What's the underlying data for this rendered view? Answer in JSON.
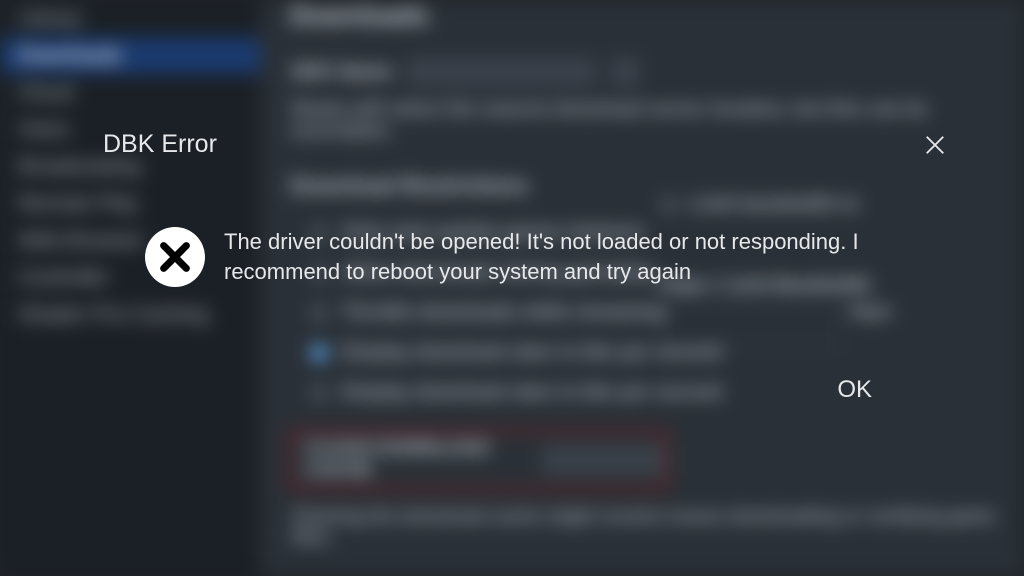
{
  "bg": {
    "sidebar": [
      "Library",
      "Downloads",
      "Cloud",
      "Voice",
      "Broadcasting",
      "Remote Play",
      "Web Browser",
      "Controller",
      "Shader Pre-Caching"
    ],
    "sidebar_selected_index": 1,
    "section_title": "Downloads",
    "region_label": "SDK Name",
    "region_desc": "Steam will select the nearest download server location, but this can be overridden.",
    "sub_header": "Download Restrictions",
    "checks": [
      "Only auto-update games between",
      "Allow downloads during gameplay",
      "Throttle downloads while streaming",
      "Display download rates in bits per second"
    ],
    "right_check": "Limit bandwidth to",
    "right_header": "Kbps / Limit Bandwidth",
    "right_suffix": "kbps",
    "redbox_label": "CLEAR DOWNLOAD CACHE",
    "bottom_desc": "Clearing the download cache might resolve issues downloading or verifying game files."
  },
  "dialog": {
    "title": "DBK Error",
    "message": "The driver couldn't be opened! It's not loaded or not responding. I recommend to reboot your system and try again",
    "ok_label": "OK"
  }
}
